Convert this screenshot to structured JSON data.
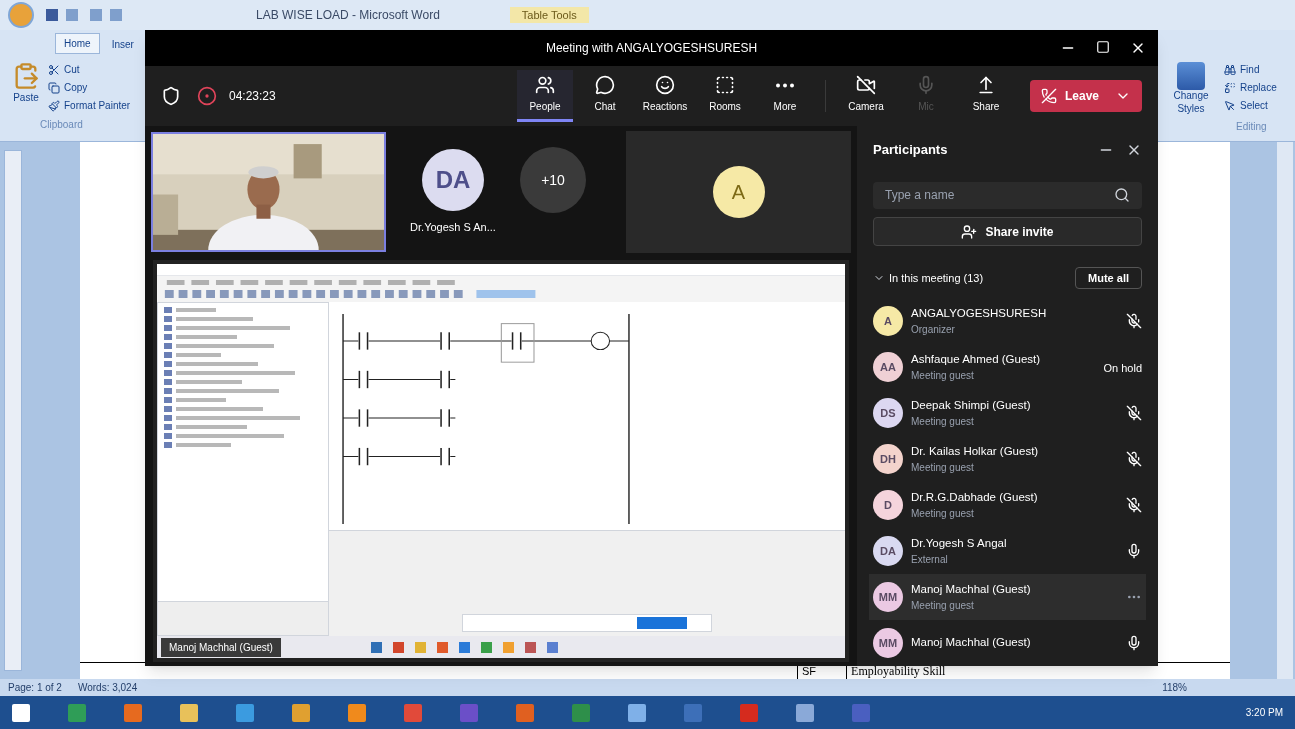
{
  "word": {
    "title": "LAB WISE LOAD - Microsoft Word",
    "context_tab": "Table Tools",
    "tabs": [
      {
        "label": "Home",
        "selected": true
      },
      {
        "label": "Inser",
        "selected": false
      }
    ],
    "clipboard": {
      "paste": "Paste",
      "items": [
        "Cut",
        "Copy",
        "Format Painter"
      ],
      "group": "Clipboard"
    },
    "editing": {
      "styles": "Change Styles",
      "items": [
        "Find",
        "Replace",
        "Select"
      ],
      "group": "Editing"
    },
    "table_row": [
      "SF",
      "Employability Skill"
    ],
    "status": {
      "page": "Page: 1 of 2",
      "words": "Words: 3,024",
      "zoom": "118%"
    }
  },
  "teams": {
    "title": "Meeting with ANGALYOGESHSURESH",
    "timer": "04:23:23",
    "toolbar": [
      {
        "kind": "people",
        "label": "People",
        "selected": true
      },
      {
        "kind": "chat",
        "label": "Chat",
        "selected": false
      },
      {
        "kind": "reactions",
        "label": "Reactions",
        "selected": false
      },
      {
        "kind": "rooms",
        "label": "Rooms",
        "selected": false
      },
      {
        "kind": "more",
        "label": "More",
        "selected": false
      },
      {
        "kind": "camera",
        "label": "Camera",
        "selected": false
      },
      {
        "kind": "mic",
        "label": "Mic",
        "selected": false
      },
      {
        "kind": "share",
        "label": "Share",
        "selected": false
      }
    ],
    "leave": "Leave",
    "tiles": [
      {
        "kind": "video"
      },
      {
        "kind": "avatar",
        "initials": "DA",
        "name": "Dr.Yogesh S An..."
      },
      {
        "kind": "overflow",
        "initials": "+10"
      },
      {
        "kind": "large-avatar",
        "initials": "A"
      }
    ],
    "presenter_tag": "Manoj Machhal (Guest)",
    "panel": {
      "title": "Participants",
      "search": {
        "placeholder": "Type a name"
      },
      "invite": "Share invite",
      "section": "In this meeting (13)",
      "mute_all": "Mute all",
      "participants": [
        {
          "initials": "A",
          "name": "ANGALYOGESHSURESH",
          "role": "Organizer",
          "color": "#f6e9a6",
          "kind": "mic-off",
          "selected": false
        },
        {
          "initials": "AA",
          "name": "Ashfaque Ahmed (Guest)",
          "role": "Meeting guest",
          "color": "#efd0d5",
          "kind": "text",
          "status_text": "On hold",
          "selected": false
        },
        {
          "initials": "DS",
          "name": "Deepak Shimpi (Guest)",
          "role": "Meeting guest",
          "color": "#dcd7f1",
          "kind": "mic-off",
          "selected": false
        },
        {
          "initials": "DH",
          "name": "Dr. Kailas Holkar (Guest)",
          "role": "Meeting guest",
          "color": "#f3d3cc",
          "kind": "mic-off",
          "selected": false
        },
        {
          "initials": "D",
          "name": "Dr.R.G.Dabhade (Guest)",
          "role": "Meeting guest",
          "color": "#f4d4dc",
          "kind": "mic-off",
          "selected": false
        },
        {
          "initials": "DA",
          "name": "Dr.Yogesh S Angal",
          "role": "External",
          "color": "#d9d9f1",
          "kind": "mic-on",
          "selected": false
        },
        {
          "initials": "MM",
          "name": "Manoj Machhal (Guest)",
          "role": "Meeting guest",
          "color": "#ebc9e3",
          "kind": "more",
          "selected": true
        },
        {
          "initials": "MM",
          "name": "Manoj Machhal (Guest)",
          "color": "#ebc9e3",
          "kind": "mic-on",
          "selected": false
        }
      ]
    }
  },
  "taskbar": {
    "time": "3:20 PM"
  }
}
